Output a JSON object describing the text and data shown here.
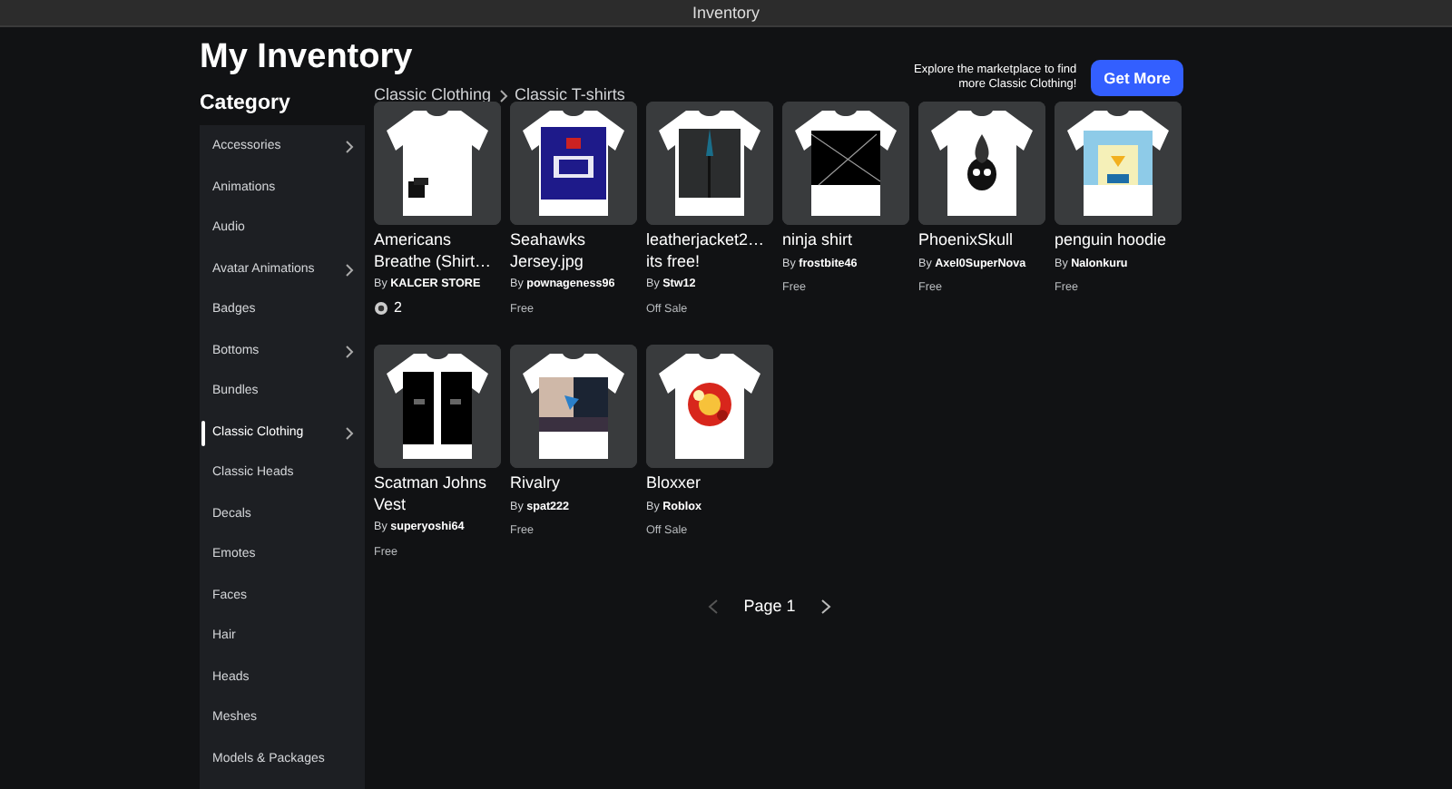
{
  "window": {
    "title": "Inventory"
  },
  "page": {
    "title": "My Inventory"
  },
  "sidebar": {
    "title": "Category",
    "items": [
      {
        "label": "Accessories",
        "expandable": true,
        "selected": false
      },
      {
        "label": "Animations",
        "expandable": false,
        "selected": false
      },
      {
        "label": "Audio",
        "expandable": false,
        "selected": false
      },
      {
        "label": "Avatar Animations",
        "expandable": true,
        "selected": false
      },
      {
        "label": "Badges",
        "expandable": false,
        "selected": false
      },
      {
        "label": "Bottoms",
        "expandable": true,
        "selected": false
      },
      {
        "label": "Bundles",
        "expandable": false,
        "selected": false
      },
      {
        "label": "Classic Clothing",
        "expandable": true,
        "selected": true
      },
      {
        "label": "Classic Heads",
        "expandable": false,
        "selected": false
      },
      {
        "label": "Decals",
        "expandable": false,
        "selected": false
      },
      {
        "label": "Emotes",
        "expandable": false,
        "selected": false
      },
      {
        "label": "Faces",
        "expandable": false,
        "selected": false
      },
      {
        "label": "Hair",
        "expandable": false,
        "selected": false
      },
      {
        "label": "Heads",
        "expandable": false,
        "selected": false
      },
      {
        "label": "Meshes",
        "expandable": false,
        "selected": false
      },
      {
        "label": "Models & Packages",
        "expandable": false,
        "selected": false
      }
    ]
  },
  "breadcrumb": [
    "Classic Clothing",
    "Classic T-shirts"
  ],
  "promo": {
    "text": "Explore the marketplace to find more Classic Clothing!",
    "button": "Get More"
  },
  "items": [
    {
      "name": "Americans Breathe (Shirt…",
      "creator": "By **KALCER STORE**",
      "price": "2",
      "robux": true
    },
    {
      "name": "Seahawks Jersey.jpg",
      "creator": "By **pownageness96**",
      "price": "Free",
      "robux": false
    },
    {
      "name": "leatherjacket2… its free!",
      "creator": "By **Stw12**",
      "price": "Off Sale",
      "robux": false
    },
    {
      "name": "ninja shirt",
      "creator": "By **frostbite46**",
      "price": "Free",
      "robux": false
    },
    {
      "name": "PhoenixSkull",
      "creator": "By **Axel0SuperNova**",
      "price": "Free",
      "robux": false
    },
    {
      "name": "penguin hoodie",
      "creator": "By **Nalonkuru**",
      "price": "Free",
      "robux": false
    },
    {
      "name": "Scatman Johns Vest",
      "creator": "By **superyoshi64**",
      "price": "Free",
      "robux": false
    },
    {
      "name": "Rivalry",
      "creator": "By **spat222**",
      "price": "Free",
      "robux": false
    },
    {
      "name": "Bloxxer",
      "creator": "By **Roblox**",
      "price": "Off Sale",
      "robux": false
    }
  ],
  "pagination": {
    "label": "Page 1",
    "prev_disabled": true,
    "next_disabled": false
  }
}
